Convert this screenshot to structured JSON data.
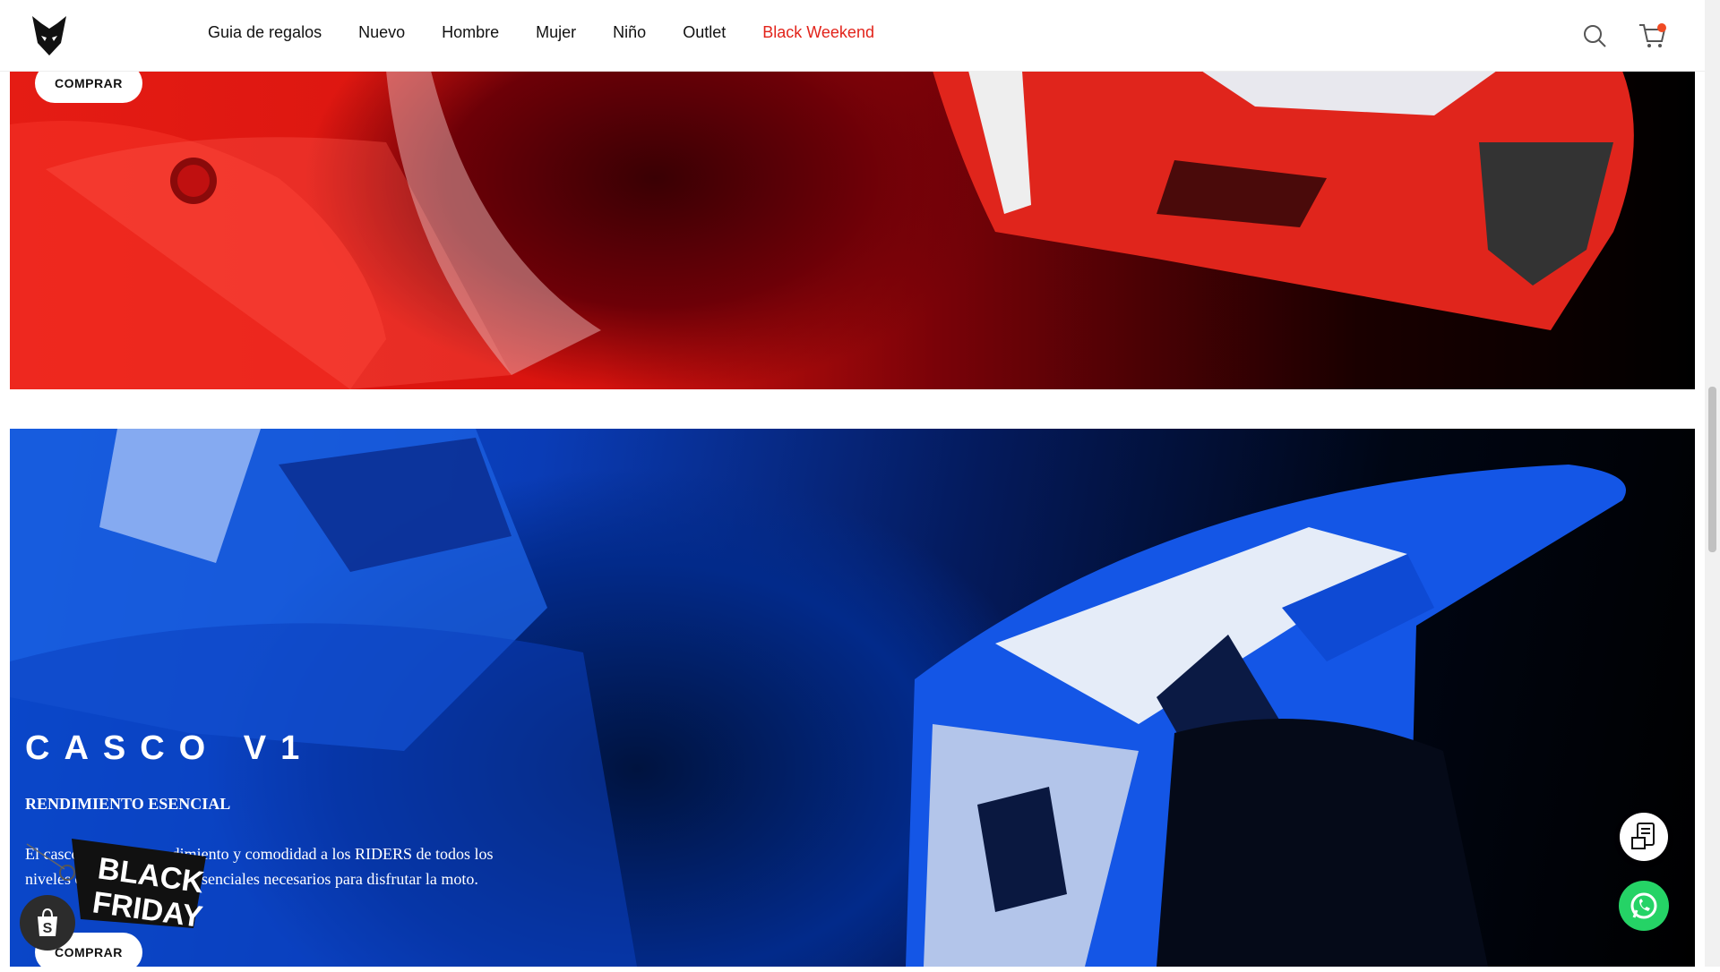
{
  "nav": {
    "items": [
      {
        "label": "Guia de regalos"
      },
      {
        "label": "Nuevo"
      },
      {
        "label": "Hombre"
      },
      {
        "label": "Mujer"
      },
      {
        "label": "Niño"
      },
      {
        "label": "Outlet"
      },
      {
        "label": "Black Weekend"
      }
    ]
  },
  "banner_red": {
    "cta": "COMPRAR"
  },
  "banner_blue": {
    "title": "CASCO V1",
    "subtitle": "RENDIMIENTO ESENCIAL",
    "description": "El casco V1 ofrece rendimiento y comodidad a los RIDERS de todos los niveles con los elementos esenciales necesarios para disfrutar la moto.",
    "cta": "COMPRAR"
  },
  "promo_badge": {
    "line1": "BLACK",
    "line2": "FRIDAY"
  },
  "colors": {
    "accent": "#e2231a",
    "cart_dot": "#f04a23",
    "whatsapp": "#25d366"
  },
  "icons": [
    "fox-logo-icon",
    "search-icon",
    "cart-icon",
    "shopify-icon",
    "order-tracking-icon",
    "whatsapp-icon"
  ]
}
